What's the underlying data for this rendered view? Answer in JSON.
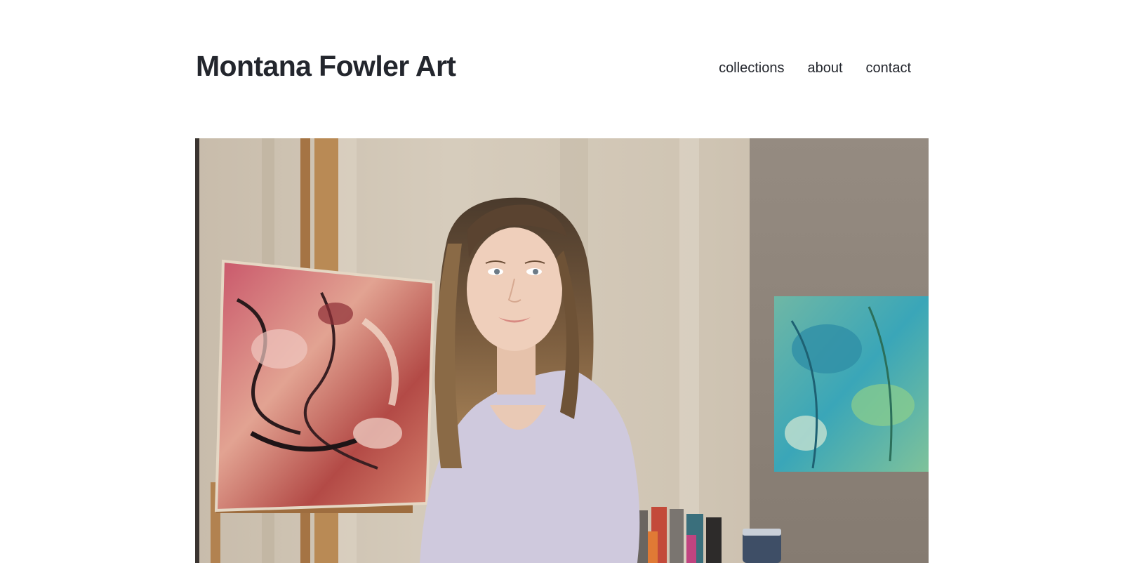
{
  "header": {
    "site_title": "Montana Fowler Art",
    "nav": [
      {
        "label": "collections"
      },
      {
        "label": "about"
      },
      {
        "label": "contact"
      }
    ]
  },
  "colors": {
    "title_text": "#23262d",
    "wall_light": "#d2c7b7",
    "wall_dark": "#8f867c",
    "easel_wood": "#b98a55",
    "sweater": "#cfc9dd"
  }
}
